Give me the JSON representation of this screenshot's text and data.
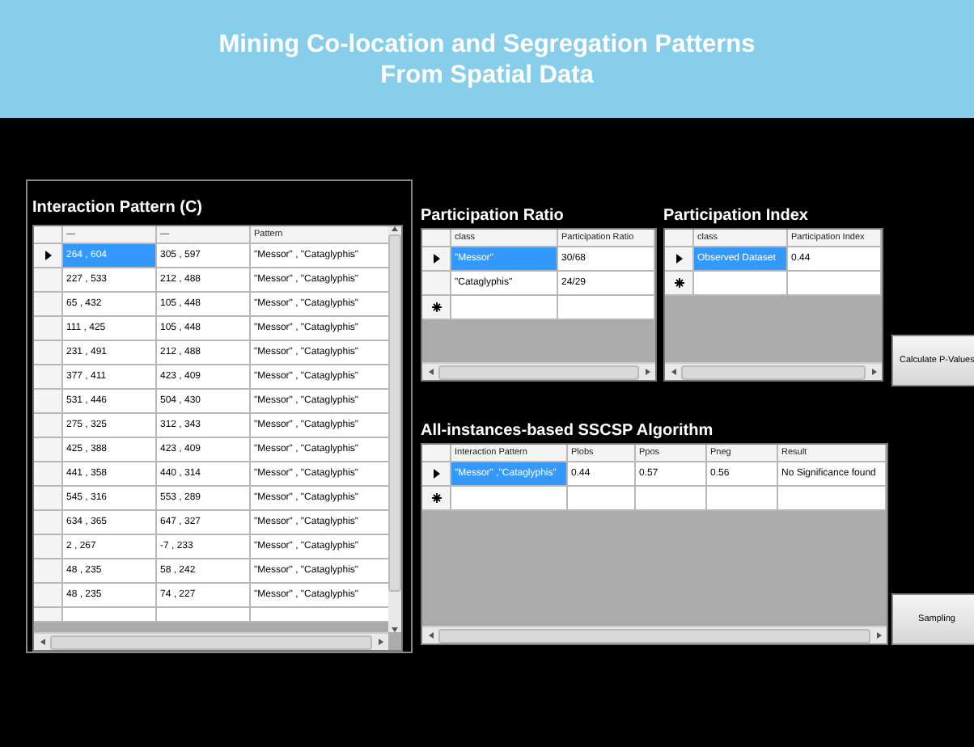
{
  "header": {
    "title_lines": [
      "Mining Co-location and Segregation Patterns",
      "From Spatial Data"
    ]
  },
  "interaction_pattern": {
    "label": "Interaction Pattern (C)",
    "grid": {
      "columns": [
        "—",
        "—",
        "Pattern"
      ],
      "rows": [
        {
          "cells": [
            "264 , 604",
            "305 , 597",
            "\"Messor\" , \"Cataglyphis\""
          ],
          "selected": true
        },
        {
          "cells": [
            "227 , 533",
            "212 , 488",
            "\"Messor\" , \"Cataglyphis\""
          ],
          "selected": false
        },
        {
          "cells": [
            "65 , 432",
            "105 , 448",
            "\"Messor\" , \"Cataglyphis\""
          ],
          "selected": false
        },
        {
          "cells": [
            "111 , 425",
            "105 , 448",
            "\"Messor\" , \"Cataglyphis\""
          ],
          "selected": false
        },
        {
          "cells": [
            "231 , 491",
            "212 , 488",
            "\"Messor\" , \"Cataglyphis\""
          ],
          "selected": false
        },
        {
          "cells": [
            "377 , 411",
            "423 , 409",
            "\"Messor\" , \"Cataglyphis\""
          ],
          "selected": false
        },
        {
          "cells": [
            "531 , 446",
            "504 , 430",
            "\"Messor\" , \"Cataglyphis\""
          ],
          "selected": false
        },
        {
          "cells": [
            "275 , 325",
            "312 , 343",
            "\"Messor\" , \"Cataglyphis\""
          ],
          "selected": false
        },
        {
          "cells": [
            "425 , 388",
            "423 , 409",
            "\"Messor\" , \"Cataglyphis\""
          ],
          "selected": false
        },
        {
          "cells": [
            "441 , 358",
            "440 , 314",
            "\"Messor\" , \"Cataglyphis\""
          ],
          "selected": false
        },
        {
          "cells": [
            "545 , 316",
            "553 , 289",
            "\"Messor\" , \"Cataglyphis\""
          ],
          "selected": false
        },
        {
          "cells": [
            "634 , 365",
            "647 , 327",
            "\"Messor\" , \"Cataglyphis\""
          ],
          "selected": false
        },
        {
          "cells": [
            "2 , 267",
            "-7 , 233",
            "\"Messor\" , \"Cataglyphis\""
          ],
          "selected": false
        },
        {
          "cells": [
            "48 , 235",
            "58 , 242",
            "\"Messor\" , \"Cataglyphis\""
          ],
          "selected": false
        },
        {
          "cells": [
            "48 , 235",
            "74 , 227",
            "\"Messor\" , \"Cataglyphis\""
          ],
          "selected": false
        }
      ]
    }
  },
  "participation_ratio": {
    "label": "Participation Ratio",
    "grid": {
      "columns": [
        "class",
        "Participation Ratio"
      ],
      "new_row": true,
      "rows": [
        {
          "cells": [
            "\"Messor\"",
            "30/68"
          ],
          "selected": true
        },
        {
          "cells": [
            "\"Cataglyphis\"",
            "24/29"
          ],
          "selected": false
        }
      ]
    }
  },
  "participation_index": {
    "label": "Participation Index",
    "grid": {
      "columns": [
        "class",
        "Participation Index"
      ],
      "new_row": true,
      "rows": [
        {
          "cells": [
            "Observed Dataset",
            "0.44"
          ],
          "selected": true
        }
      ]
    }
  },
  "calculate_button": "Calculate P-Values",
  "sscsp": {
    "label": "All-instances-based SSCSP Algorithm",
    "grid": {
      "columns": [
        "Interaction Pattern",
        "Plobs",
        "Ppos",
        "Pneg",
        "Result"
      ],
      "new_row": true,
      "rows": [
        {
          "cells": [
            "\"Messor\" ,\"Cataglyphis\"",
            "0.44",
            "0.57",
            "0.56",
            "No Significance found"
          ],
          "selected": true
        }
      ]
    }
  },
  "sampling_button": "Sampling"
}
